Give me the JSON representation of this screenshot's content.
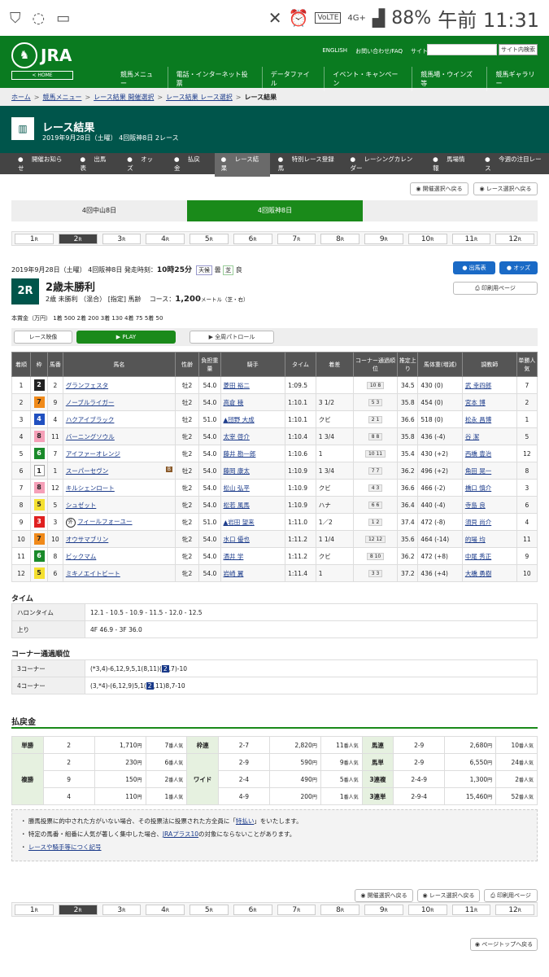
{
  "status": {
    "time": "午前 11:31",
    "battery": "88%",
    "network": "4G+",
    "volte": "VoLTE"
  },
  "header": {
    "logo": "JRA",
    "home": "< HOME",
    "links": [
      "ENGLISH",
      "お問い合わせ/FAQ",
      "サイトマップ"
    ],
    "search_button": "サイト内検索",
    "nav": [
      "競馬メニュー",
      "電話・インターネット投票",
      "データファイル",
      "イベント・キャンペーン",
      "競馬場・ウインズ等",
      "競馬ギャラリー"
    ]
  },
  "breadcrumb": [
    "ホーム",
    "競馬メニュー",
    "レース結果 開催選択",
    "レース結果 レース選択",
    "レース結果"
  ],
  "page": {
    "title": "レース結果",
    "date": "2019年9月28日（土曜） 4回阪神8日 2レース"
  },
  "subnav": [
    "開催お知らせ",
    "出馬表",
    "オッズ",
    "払戻金",
    "レース結果",
    "特別レース登録馬",
    "レーシングカレンダー",
    "馬場情報",
    "今週の注目レース"
  ],
  "tool": {
    "back_venue": "開催選択へ戻る",
    "back_race": "レース選択へ戻る",
    "print": "印刷用ページ",
    "page_top": "ページトップへ戻る"
  },
  "venues": [
    "4回中山8日",
    "4回阪神8日"
  ],
  "races": [
    "1",
    "2",
    "3",
    "4",
    "5",
    "6",
    "7",
    "8",
    "9",
    "10",
    "11",
    "12"
  ],
  "race_suffix": "R",
  "race": {
    "dateline": "2019年9月28日（土曜）  4回阪神8日  発走時刻：",
    "start_time": "10時25分",
    "weather_label": "天候",
    "weather": "曇",
    "track_label": "芝",
    "track": "良",
    "number": "2R",
    "name": "2歳未勝利",
    "conditions": "2歳  未勝利  （混合）  [指定]  馬齢",
    "course_label": "コース：",
    "distance": "1,200",
    "course_unit": "メートル（芝・右）",
    "prize": "本賞金（万円）  1着  500  2着  200  3着  130  4着  75  5着  50",
    "btn_shutsuba": "出馬表",
    "btn_odds": "オッズ",
    "btn_print": "印刷用ページ",
    "video": "レース映像",
    "play": "PLAY",
    "patrol": "全周パトロール"
  },
  "results_headers": [
    "着順",
    "枠",
    "馬番",
    "馬名",
    "性齢",
    "負担重量",
    "騎手",
    "タイム",
    "着差",
    "コーナー通過順位",
    "推定上り",
    "馬体重(増減)",
    "調教師",
    "単勝人気"
  ],
  "results": [
    {
      "pos": "1",
      "waku": "2",
      "num": "2",
      "horse": "グランフェスタ",
      "sexage": "牡2",
      "weight": "54.0",
      "jockey": "菱田 裕二",
      "time": "1:09.5",
      "margin": "",
      "corner": "10  8",
      "last": "34.5",
      "body": "430 (0)",
      "trainer": "武 幸四郎",
      "pop": "7"
    },
    {
      "pos": "2",
      "waku": "7",
      "num": "9",
      "horse": "ノーブルライガー",
      "sexage": "牡2",
      "weight": "54.0",
      "jockey": "高倉 稜",
      "time": "1:10.1",
      "margin": "3 1/2",
      "corner": "5  3",
      "last": "35.8",
      "body": "454 (0)",
      "trainer": "宮本 博",
      "pop": "2"
    },
    {
      "pos": "3",
      "waku": "4",
      "num": "4",
      "horse": "ハクアイブラック",
      "sexage": "牡2",
      "weight": "51.0",
      "jockey": "▲団野 大成",
      "time": "1:10.1",
      "margin": "クビ",
      "corner": "2  1",
      "last": "36.6",
      "body": "518 (0)",
      "trainer": "松永 昌博",
      "pop": "1"
    },
    {
      "pos": "4",
      "waku": "8",
      "num": "11",
      "horse": "バーニングソウル",
      "sexage": "牝2",
      "weight": "54.0",
      "jockey": "太宰 啓介",
      "time": "1:10.4",
      "margin": "1 3/4",
      "corner": "8  8",
      "last": "35.8",
      "body": "436 (-4)",
      "trainer": "谷 潔",
      "pop": "5"
    },
    {
      "pos": "5",
      "waku": "6",
      "num": "7",
      "horse": "アイファーオレンジ",
      "sexage": "牝2",
      "weight": "54.0",
      "jockey": "藤井 勘一郎",
      "time": "1:10.6",
      "margin": "1",
      "corner": "10  11",
      "last": "35.4",
      "body": "430 (+2)",
      "trainer": "西橋 豊治",
      "pop": "12"
    },
    {
      "pos": "6",
      "waku": "1",
      "num": "1",
      "horse": "スーパーセヴン",
      "sexage": "牡2",
      "weight": "54.0",
      "jockey": "藤岡 康太",
      "time": "1:10.9",
      "margin": "1 3/4",
      "corner": "7  7",
      "last": "36.2",
      "body": "496 (+2)",
      "trainer": "角田 晃一",
      "pop": "8",
      "blinker": "B"
    },
    {
      "pos": "7",
      "waku": "8",
      "num": "12",
      "horse": "キルシェンロート",
      "sexage": "牝2",
      "weight": "54.0",
      "jockey": "松山 弘平",
      "time": "1:10.9",
      "margin": "クビ",
      "corner": "4  3",
      "last": "36.6",
      "body": "466 (-2)",
      "trainer": "橋口 慎介",
      "pop": "3"
    },
    {
      "pos": "8",
      "waku": "5",
      "num": "5",
      "horse": "シュゼット",
      "sexage": "牝2",
      "weight": "54.0",
      "jockey": "松若 風馬",
      "time": "1:10.9",
      "margin": "ハナ",
      "corner": "6  6",
      "last": "36.4",
      "body": "440 (-4)",
      "trainer": "寺島 良",
      "pop": "6"
    },
    {
      "pos": "9",
      "waku": "3",
      "num": "3",
      "horse": "フィールフォーユー",
      "sexage": "牝2",
      "weight": "51.0",
      "jockey": "▲岩田 望来",
      "time": "1:11.0",
      "margin": "1／2",
      "corner": "1  2",
      "last": "37.4",
      "body": "472 (-8)",
      "trainer": "須貝 尚介",
      "pop": "4",
      "mark": "外"
    },
    {
      "pos": "10",
      "waku": "7",
      "num": "10",
      "horse": "オウサマブリン",
      "sexage": "牝2",
      "weight": "54.0",
      "jockey": "水口 優也",
      "time": "1:11.2",
      "margin": "1 1/4",
      "corner": "12  12",
      "last": "35.6",
      "body": "464 (-14)",
      "trainer": "的場 均",
      "pop": "11"
    },
    {
      "pos": "11",
      "waku": "6",
      "num": "8",
      "horse": "ビックマム",
      "sexage": "牝2",
      "weight": "54.0",
      "jockey": "酒井 学",
      "time": "1:11.2",
      "margin": "クビ",
      "corner": "8  10",
      "last": "36.2",
      "body": "472 (+8)",
      "trainer": "中尾 秀正",
      "pop": "9"
    },
    {
      "pos": "12",
      "waku": "5",
      "num": "6",
      "horse": "ミキノエイトビート",
      "sexage": "牝2",
      "weight": "54.0",
      "jockey": "岩崎 翼",
      "time": "1:11.4",
      "margin": "1",
      "corner": "3  3",
      "last": "37.2",
      "body": "436 (+4)",
      "trainer": "大橋 勇樹",
      "pop": "10"
    }
  ],
  "waku_colors": {
    "1": [
      "#ffffff",
      "#222"
    ],
    "2": [
      "#222222",
      "#fff"
    ],
    "3": [
      "#e02020",
      "#fff"
    ],
    "4": [
      "#2050c0",
      "#fff"
    ],
    "5": [
      "#f5e030",
      "#222"
    ],
    "6": [
      "#1a8a2a",
      "#fff"
    ],
    "7": [
      "#f08a1a",
      "#222"
    ],
    "8": [
      "#f5a0b8",
      "#222"
    ]
  },
  "time_section": {
    "title": "タイム",
    "rows": [
      {
        "k": "ハロンタイム",
        "v": "12.1 - 10.5 - 10.9 - 11.5 - 12.0 - 12.5"
      },
      {
        "k": "上り",
        "v": "4F 46.9 - 3F 36.0"
      }
    ]
  },
  "corner_section": {
    "title": "コーナー通過順位",
    "rows": [
      {
        "k": "3コーナー",
        "pre": "(*3,4)-6,12,9,5,1(8,11)(",
        "hl": "2",
        "post": ",7)-10"
      },
      {
        "k": "4コーナー",
        "pre": "(3,*4)-(6,12,9)5,1(",
        "hl": "2",
        "post": ",11)8,7-10"
      }
    ]
  },
  "payout": {
    "title": "払戻金",
    "tansho": "単勝",
    "fukusho": "複勝",
    "wakuren": "枠連",
    "wide": "ワイド",
    "umaren": "馬連",
    "umatan": "馬単",
    "sanrenpuku": "3連複",
    "sanrentan": "3連単",
    "yen": "円",
    "rows": [
      {
        "a_num": "2",
        "a_amt": "1,710",
        "a_pop": "7",
        "b_num": "2-7",
        "b_amt": "2,820",
        "b_pop": "11",
        "c_num": "2-9",
        "c_amt": "2,680",
        "c_pop": "10"
      },
      {
        "a_num": "2",
        "a_amt": "230",
        "a_pop": "6",
        "b_num": "2-9",
        "b_amt": "590",
        "b_pop": "9",
        "c_num": "2-9",
        "c_amt": "6,550",
        "c_pop": "24"
      },
      {
        "a_num": "9",
        "a_amt": "150",
        "a_pop": "2",
        "b_num": "2-4",
        "b_amt": "490",
        "b_pop": "5",
        "c_num": "2-4-9",
        "c_amt": "1,300",
        "c_pop": "2"
      },
      {
        "a_num": "4",
        "a_amt": "110",
        "a_pop": "1",
        "b_num": "4-9",
        "b_amt": "200",
        "b_pop": "1",
        "c_num": "2-9-4",
        "c_amt": "15,460",
        "c_pop": "52"
      }
    ],
    "pop_suffix": "番人気"
  },
  "notes": {
    "n1_pre": "勝馬投票に的中された方がいない場合、その投票法に投票された方全員に「",
    "n1_link": "特払い",
    "n1_post": "」をいたします。",
    "n2_pre": "特定の馬番・組番に人気が著しく集中した場合、",
    "n2_link": "JRAプラス10",
    "n2_post": "の対象にならないことがあります。",
    "n3_link": "レースや騎手等につく記号"
  }
}
